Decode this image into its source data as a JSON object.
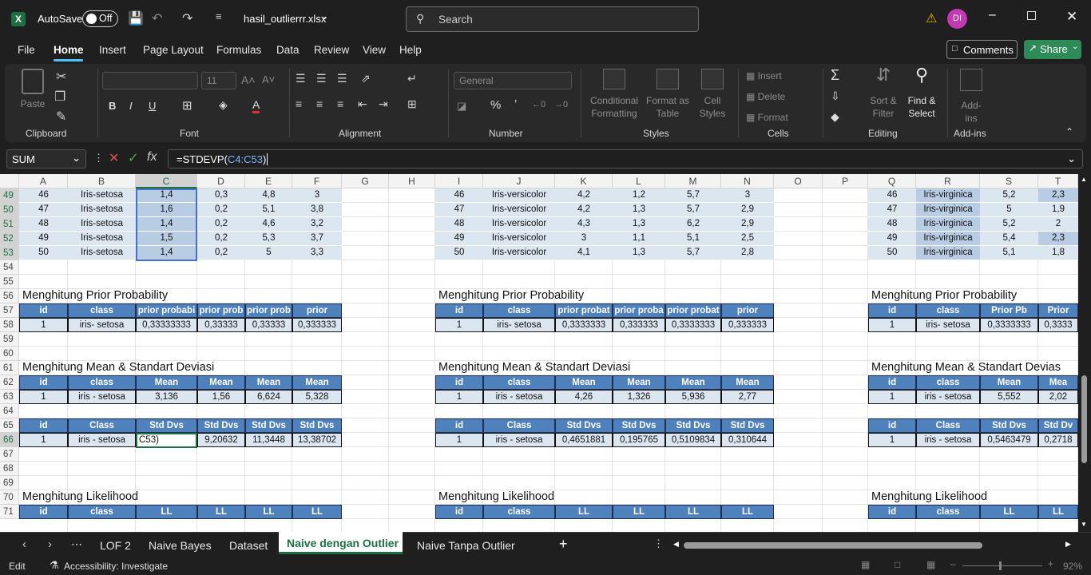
{
  "title_bar": {
    "autosave": "AutoSave",
    "toggle": "Off",
    "filename": "hasil_outlierrr.xlsx",
    "search": "Search",
    "user_initials": "DI"
  },
  "tabs": [
    "File",
    "Home",
    "Insert",
    "Page Layout",
    "Formulas",
    "Data",
    "Review",
    "View",
    "Help"
  ],
  "comments": "Comments",
  "share": "Share",
  "ribbon": {
    "paste": "Paste",
    "font_size": "11",
    "number_format": "General",
    "groups": {
      "clipboard": "Clipboard",
      "font": "Font",
      "alignment": "Alignment",
      "number": "Number",
      "styles": "Styles",
      "cells": "Cells",
      "editing": "Editing",
      "addins": "Add-ins"
    },
    "cond": "Conditional\nFormatting",
    "fmt_table": "Format as\nTable",
    "cell_styles": "Cell\nStyles",
    "insert": "Insert",
    "delete": "Delete",
    "format": "Format",
    "sort": "Sort &\nFilter",
    "find": "Find &\nSelect",
    "addins_btn": "Add-ins"
  },
  "name_box": "SUM",
  "formula_prefix": "=STDEVP(",
  "formula_ref": "C4:C53",
  "formula_suffix": ")",
  "col_headers": [
    "A",
    "B",
    "C",
    "D",
    "E",
    "F",
    "G",
    "H",
    "I",
    "J",
    "K",
    "L",
    "M",
    "N",
    "O",
    "P",
    "Q",
    "R",
    "S",
    "T"
  ],
  "row_headers": [
    "49",
    "50",
    "51",
    "52",
    "53",
    "54",
    "55",
    "56",
    "57",
    "58",
    "59",
    "60",
    "61",
    "62",
    "63",
    "64",
    "65",
    "66",
    "67",
    "68",
    "69",
    "70",
    "71"
  ],
  "setosa_rows": [
    [
      "46",
      "Iris-setosa",
      "1,4",
      "0,3",
      "4,8",
      "3"
    ],
    [
      "47",
      "Iris-setosa",
      "1,6",
      "0,2",
      "5,1",
      "3,8"
    ],
    [
      "48",
      "Iris-setosa",
      "1,4",
      "0,2",
      "4,6",
      "3,2"
    ],
    [
      "49",
      "Iris-setosa",
      "1,5",
      "0,2",
      "5,3",
      "3,7"
    ],
    [
      "50",
      "Iris-setosa",
      "1,4",
      "0,2",
      "5",
      "3,3"
    ]
  ],
  "versicolor_rows": [
    [
      "46",
      "Iris-versicolor",
      "4,2",
      "1,2",
      "5,7",
      "3"
    ],
    [
      "47",
      "Iris-versicolor",
      "4,2",
      "1,3",
      "5,7",
      "2,9"
    ],
    [
      "48",
      "Iris-versicolor",
      "4,3",
      "1,3",
      "6,2",
      "2,9"
    ],
    [
      "49",
      "Iris-versicolor",
      "3",
      "1,1",
      "5,1",
      "2,5"
    ],
    [
      "50",
      "Iris-versicolor",
      "4,1",
      "1,3",
      "5,7",
      "2,8"
    ]
  ],
  "virginica_rows": [
    [
      "46",
      "Iris-virginica",
      "5,2",
      "2,3"
    ],
    [
      "47",
      "Iris-virginica",
      "5",
      "1,9"
    ],
    [
      "48",
      "Iris-virginica",
      "5,2",
      "2"
    ],
    [
      "49",
      "Iris-virginica",
      "5,4",
      "2,3"
    ],
    [
      "50",
      "Iris-virginica",
      "5,1",
      "1,8"
    ]
  ],
  "titles": {
    "prior": "Menghitung Prior Probability",
    "mean": "Menghitung Mean & Standart Deviasi",
    "mean_cut": "Menghitung Mean & Standart Devias",
    "likelihood": "Menghitung Likelihood"
  },
  "block1": {
    "prior_hdr": [
      "id",
      "class",
      "prior probabi",
      "prior prob",
      "prior prob",
      "prior"
    ],
    "prior_row": [
      "1",
      "iris- setosa",
      "0,33333333",
      "0,33333",
      "0,33333",
      "0,333333"
    ],
    "mean_hdr": [
      "id",
      "class",
      "Mean",
      "Mean",
      "Mean",
      "Mean"
    ],
    "mean_row": [
      "1",
      "iris - setosa",
      "3,136",
      "1,56",
      "6,624",
      "5,328"
    ],
    "std_hdr": [
      "id",
      "Class",
      "Std Dvs",
      "Std Dvs",
      "Std Dvs",
      "Std Dvs"
    ],
    "std_row": [
      "1",
      "iris - setosa",
      "C53)",
      "9,20632",
      "11,3448",
      "13,38702"
    ],
    "ll_hdr": [
      "id",
      "class",
      "LL",
      "LL",
      "LL",
      "LL"
    ]
  },
  "block2": {
    "prior_hdr": [
      "id",
      "class",
      "prior probat",
      "prior proba",
      "prior probat",
      "prior"
    ],
    "prior_row": [
      "1",
      "iris- setosa",
      "0,3333333",
      "0,333333",
      "0,3333333",
      "0,333333"
    ],
    "mean_hdr": [
      "id",
      "class",
      "Mean",
      "Mean",
      "Mean",
      "Mean"
    ],
    "mean_row": [
      "1",
      "iris - setosa",
      "4,26",
      "1,326",
      "5,936",
      "2,77"
    ],
    "std_hdr": [
      "id",
      "Class",
      "Std Dvs",
      "Std Dvs",
      "Std Dvs",
      "Std Dvs"
    ],
    "std_row": [
      "1",
      "iris - setosa",
      "0,4651881",
      "0,195765",
      "0,5109834",
      "0,310644"
    ],
    "ll_hdr": [
      "id",
      "class",
      "LL",
      "LL",
      "LL",
      "LL"
    ]
  },
  "block3": {
    "prior_hdr": [
      "id",
      "class",
      "Prior Pb",
      "Prior"
    ],
    "prior_row": [
      "1",
      "iris- setosa",
      "0,3333333",
      "0,3333"
    ],
    "mean_hdr": [
      "id",
      "class",
      "Mean",
      "Mea"
    ],
    "mean_row": [
      "1",
      "iris - setosa",
      "5,552",
      "2,02"
    ],
    "std_hdr": [
      "id",
      "Class",
      "Std Dvs",
      "Std Dv"
    ],
    "std_row": [
      "1",
      "iris - setosa",
      "0,5463479",
      "0,2718"
    ],
    "ll_hdr": [
      "id",
      "class",
      "LL",
      "LL"
    ]
  },
  "sheet_tabs": [
    "LOF 2",
    "Naive Bayes",
    "Dataset",
    "Naive dengan Outlier",
    "Naive Tanpa Outlier"
  ],
  "status": {
    "mode": "Edit",
    "accessibility": "Accessibility: Investigate",
    "zoom": "92%"
  }
}
